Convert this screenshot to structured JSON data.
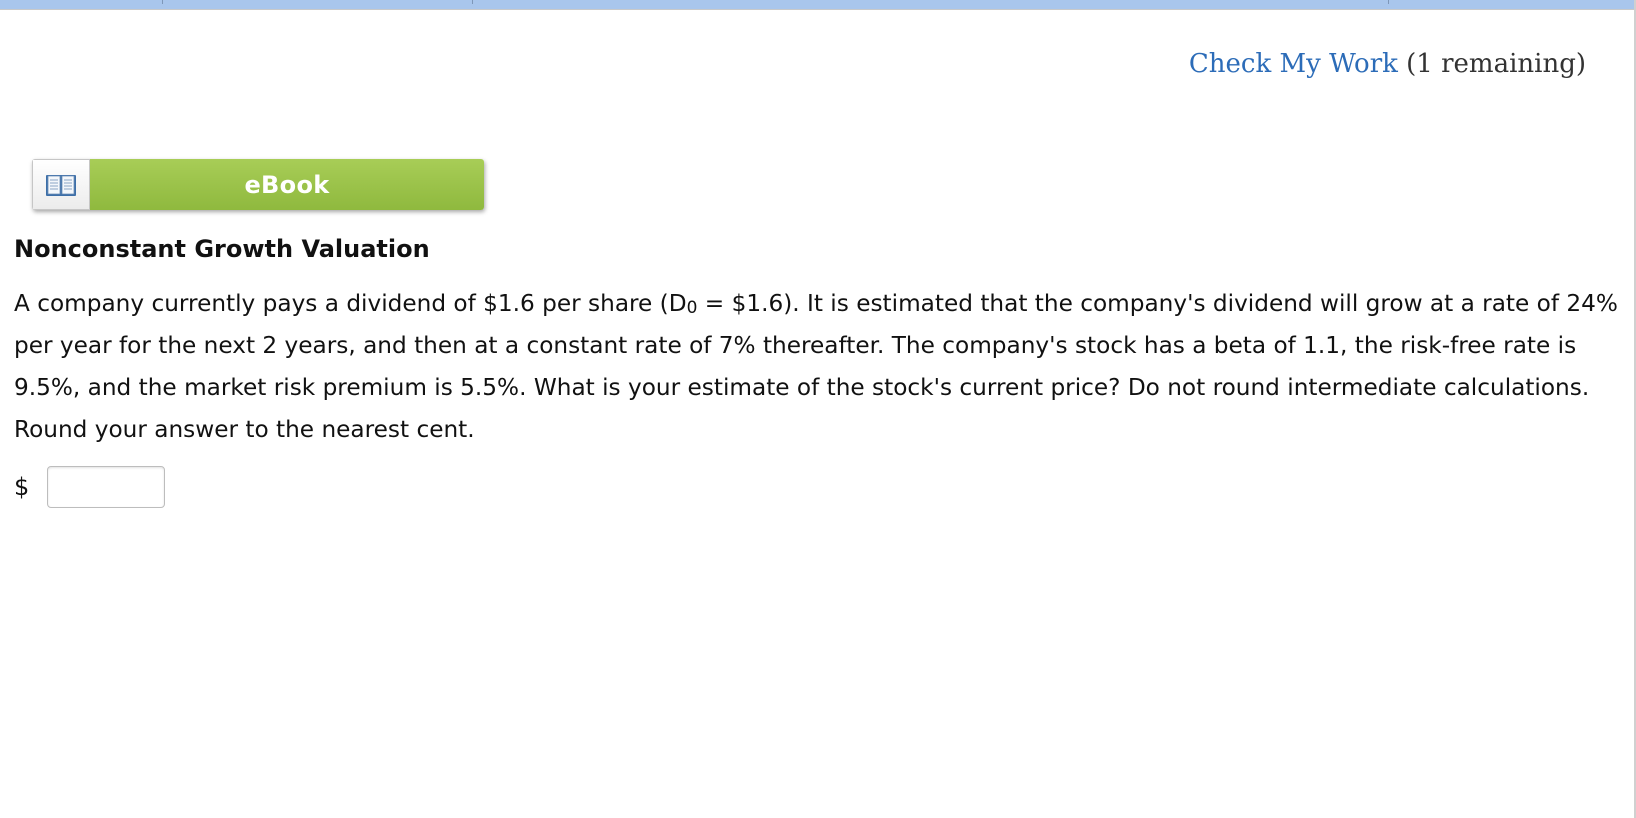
{
  "check_work": {
    "link_label": "Check My Work",
    "remaining_text": "(1 remaining)"
  },
  "ebook": {
    "icon": "open-book-icon",
    "label": "eBook"
  },
  "question": {
    "title": "Nonconstant Growth Valuation",
    "text_part1": "A company currently pays a dividend of $1.6 per share (D",
    "subscript": "0",
    "text_part2": " = $1.6). It is estimated that the company's dividend will grow at a rate of 24% per year for the next 2 years, and then at a constant rate of 7% thereafter. The company's stock has a beta of 1.1, the risk-free rate is 9.5%, and the market risk premium is 5.5%. What is your estimate of the stock's current price? Do not round intermediate calculations. Round your answer to the nearest cent."
  },
  "answer": {
    "currency_symbol": "$",
    "value": ""
  },
  "colors": {
    "link": "#2c6cb8",
    "ebook_green": "#9bc44a",
    "top_strip": "#a9c6ec"
  }
}
